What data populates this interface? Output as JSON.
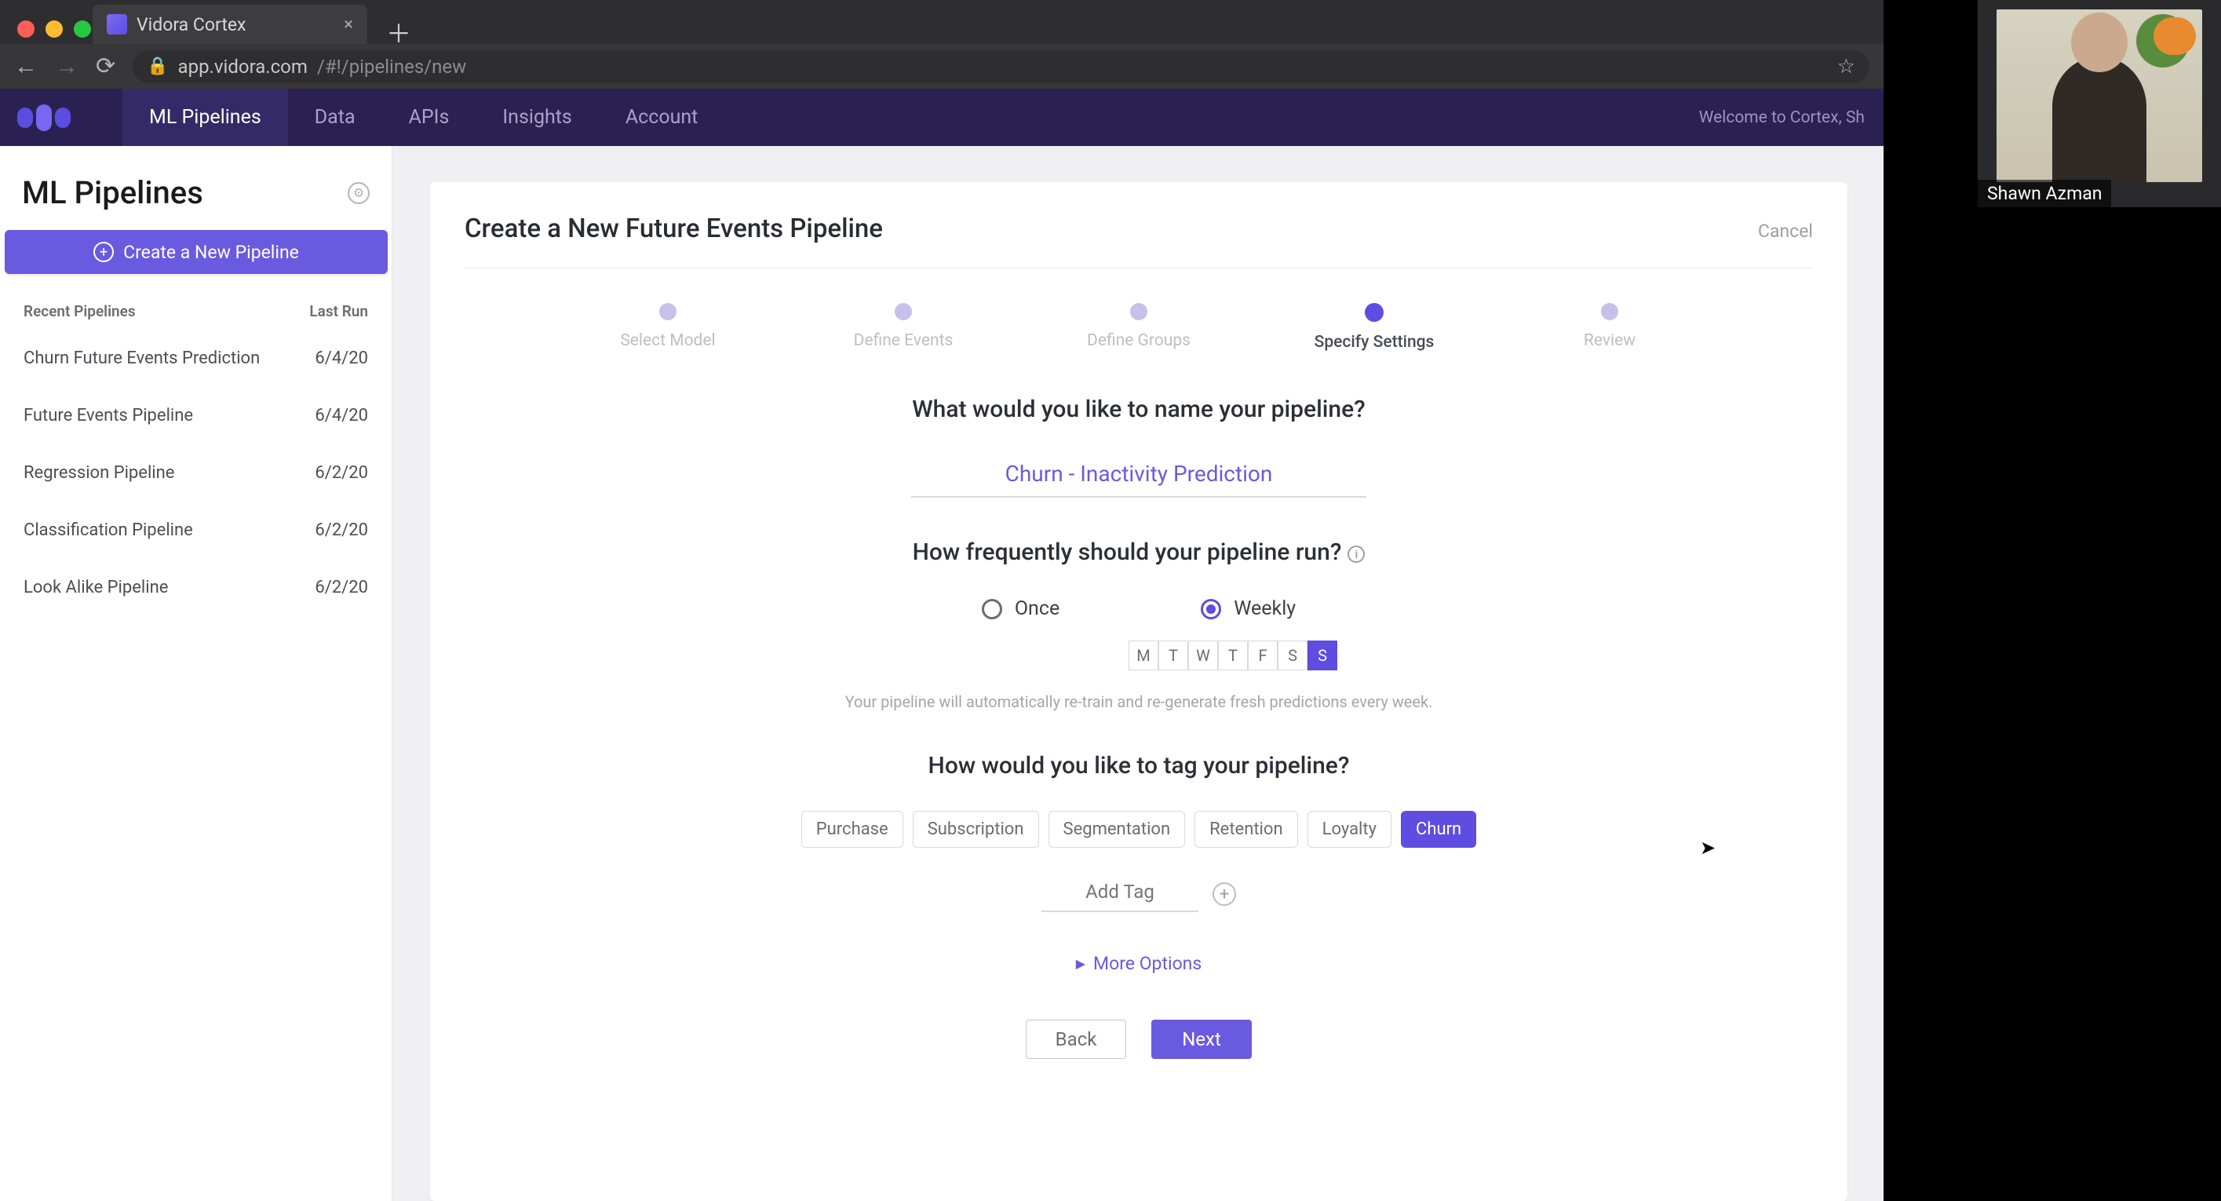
{
  "browser": {
    "tab_title": "Vidora Cortex",
    "url_host": "app.vidora.com",
    "url_path": "/#!/pipelines/new"
  },
  "nav": {
    "items": [
      "ML Pipelines",
      "Data",
      "APIs",
      "Insights",
      "Account"
    ],
    "active_index": 0,
    "welcome": "Welcome to Cortex, Sh"
  },
  "sidebar": {
    "title": "ML Pipelines",
    "create_label": "Create a New Pipeline",
    "headers": {
      "name": "Recent Pipelines",
      "lastrun": "Last Run"
    },
    "rows": [
      {
        "name": "Churn Future Events Prediction",
        "lastrun": "6/4/20"
      },
      {
        "name": "Future Events Pipeline",
        "lastrun": "6/4/20"
      },
      {
        "name": "Regression Pipeline",
        "lastrun": "6/2/20"
      },
      {
        "name": "Classification Pipeline",
        "lastrun": "6/2/20"
      },
      {
        "name": "Look Alike Pipeline",
        "lastrun": "6/2/20"
      }
    ]
  },
  "main": {
    "title": "Create a New Future Events Pipeline",
    "cancel": "Cancel",
    "steps": [
      "Select Model",
      "Define Events",
      "Define Groups",
      "Specify Settings",
      "Review"
    ],
    "active_step": 3,
    "q_name": "What would you like to name your pipeline?",
    "name_value": "Churn - Inactivity Prediction",
    "q_freq": "How frequently should your pipeline run?",
    "freq_options": {
      "once": "Once",
      "weekly": "Weekly"
    },
    "days": [
      "M",
      "T",
      "W",
      "T",
      "F",
      "S",
      "S"
    ],
    "selected_day_index": 6,
    "freq_hint": "Your pipeline will automatically re-train and re-generate fresh predictions every week.",
    "q_tag": "How would you like to tag your pipeline?",
    "tags": [
      "Purchase",
      "Subscription",
      "Segmentation",
      "Retention",
      "Loyalty",
      "Churn"
    ],
    "selected_tag_index": 5,
    "add_tag_placeholder": "Add Tag",
    "more_options": "More Options",
    "back": "Back",
    "next": "Next"
  },
  "video": {
    "name": "Shawn Azman"
  }
}
